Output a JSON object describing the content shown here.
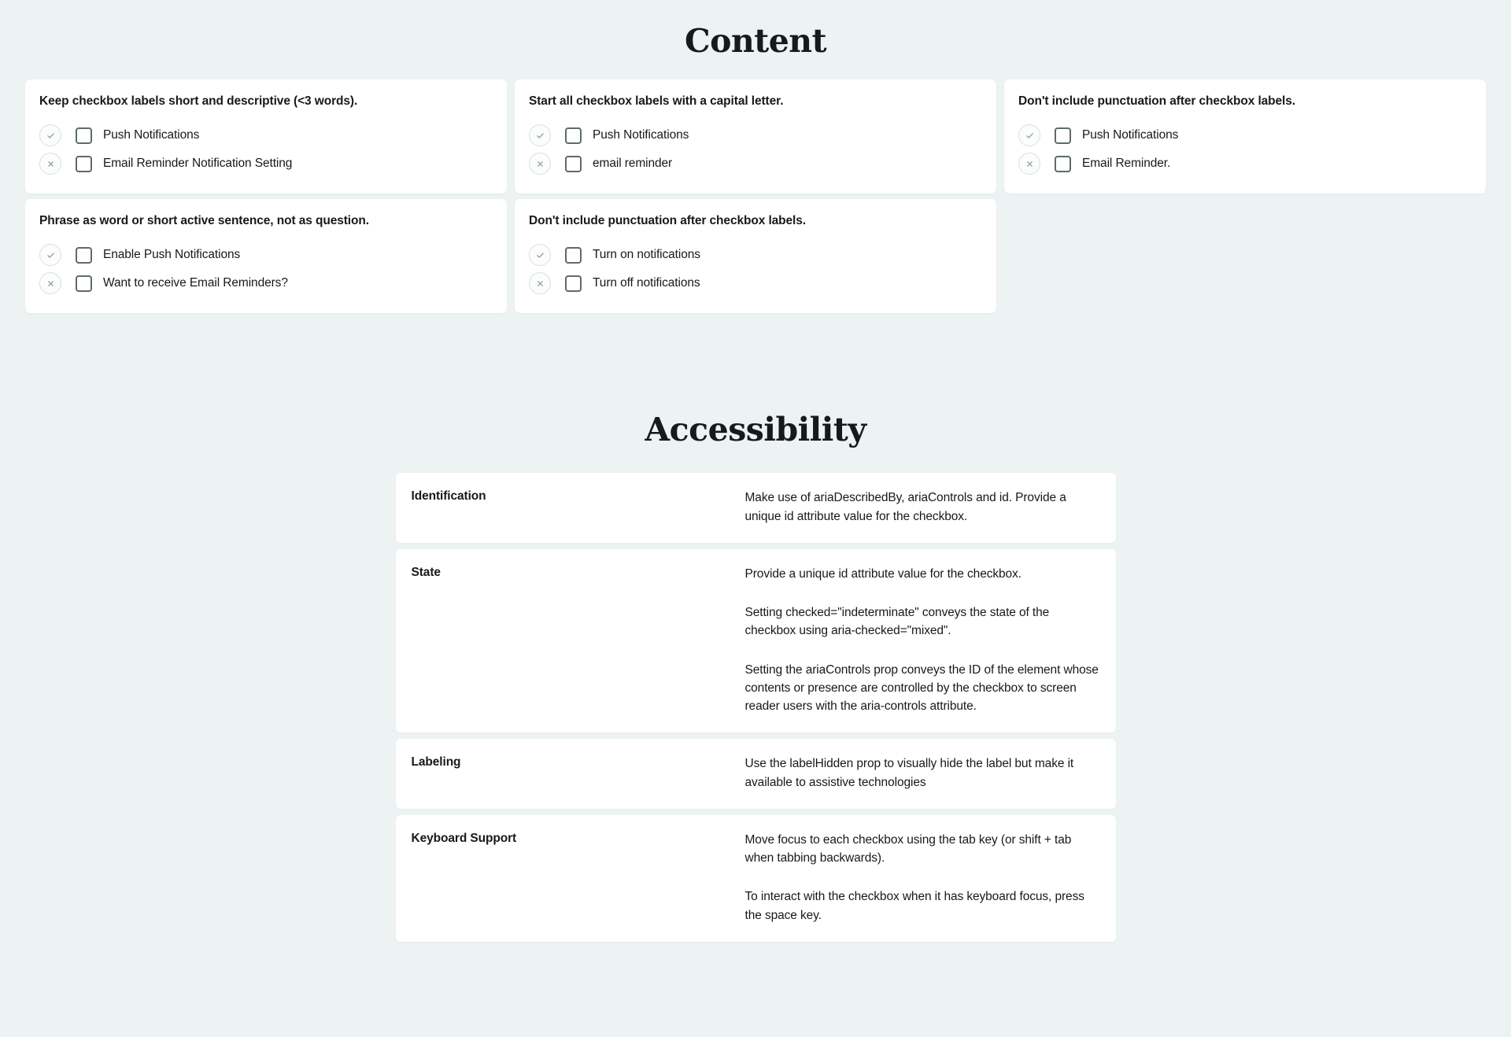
{
  "content": {
    "heading": "Content",
    "cards": [
      {
        "title": "Keep checkbox labels short and descriptive (<3 words).",
        "examples": [
          {
            "verdict": "check-icon",
            "label": "Push Notifications"
          },
          {
            "verdict": "cross-icon",
            "label": "Email Reminder Notification Setting"
          }
        ]
      },
      {
        "title": "Start all checkbox labels with a capital letter.",
        "examples": [
          {
            "verdict": "check-icon",
            "label": "Push Notifications"
          },
          {
            "verdict": "cross-icon",
            "label": "email reminder"
          }
        ]
      },
      {
        "title": "Don't include punctuation after checkbox labels.",
        "examples": [
          {
            "verdict": "check-icon",
            "label": "Push Notifications"
          },
          {
            "verdict": "cross-icon",
            "label": "Email Reminder."
          }
        ]
      },
      {
        "title": "Phrase as word or short active sentence, not as question.",
        "examples": [
          {
            "verdict": "check-icon",
            "label": "Enable Push Notifications"
          },
          {
            "verdict": "cross-icon",
            "label": "Want to receive Email Reminders?"
          }
        ]
      },
      {
        "title": "Don't include punctuation after checkbox labels.",
        "examples": [
          {
            "verdict": "check-icon",
            "label": "Turn on notifications"
          },
          {
            "verdict": "cross-icon",
            "label": "Turn off notifications"
          }
        ]
      }
    ]
  },
  "accessibility": {
    "heading": "Accessibility",
    "rows": [
      {
        "term": "Identification",
        "paragraphs": [
          "Make use of ariaDescribedBy, ariaControls and id. Provide a unique id attribute value for the checkbox."
        ]
      },
      {
        "term": "State",
        "paragraphs": [
          "Provide a unique id attribute value for the checkbox.",
          "Setting checked=\"indeterminate\" conveys the state of the checkbox using aria-checked=\"mixed\".",
          "Setting the ariaControls prop conveys the ID of the element whose contents or presence are controlled by the checkbox to screen reader users with the aria-controls attribute."
        ]
      },
      {
        "term": "Labeling",
        "paragraphs": [
          "Use the labelHidden prop to visually hide the label but make it available to assistive technologies"
        ]
      },
      {
        "term": "Keyboard Support",
        "paragraphs": [
          "Move focus to each checkbox using the tab key (or shift + tab when tabbing backwards).",
          "To interact with the checkbox when it has keyboard focus, press the space key."
        ]
      }
    ]
  },
  "colors": {
    "page_background": "#edf2f2",
    "card_background": "#ffffff",
    "text": "#16191d",
    "badge_border": "#dcdfdf",
    "badge_glyph": "#8a9090",
    "checkbox_border": "#5f6a6a"
  }
}
